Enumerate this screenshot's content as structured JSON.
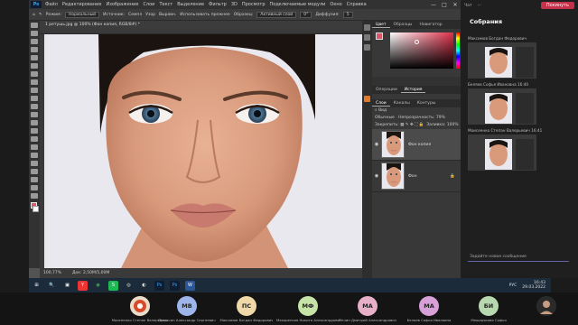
{
  "photoshop": {
    "menu": [
      "Файл",
      "Редактирование",
      "Изображение",
      "Слои",
      "Текст",
      "Выделение",
      "Фильтр",
      "3D",
      "Просмотр",
      "Подключаемые модули",
      "Окно",
      "Справка"
    ],
    "logo": "Ps",
    "window_controls": [
      "—",
      "□",
      "✕"
    ],
    "options": {
      "mode_label": "Режим:",
      "mode_value": "Нормальный",
      "source_label": "Источник:",
      "source_sample": "Семпл",
      "source_pattern": "Узор",
      "aligned": "Выравн.",
      "use_legacy": "Использовать прежнее",
      "sample_label": "Образец:",
      "sample_value": "Активный слой",
      "angle": "0°",
      "diffusion_label": "Диффузия:",
      "diffusion_value": "5"
    },
    "doc_tab": "1 ретушь.jpg @ 100% (Фон копия, RGB/8#) *",
    "status": {
      "zoom": "100,77%",
      "doc": "Док: 2,50М/5,00М"
    },
    "color_tabs": [
      "Цвет",
      "Образцы",
      "Навигатор"
    ],
    "history_tabs": [
      "Операции",
      "История"
    ],
    "layers_tabs": [
      "Слои",
      "Каналы",
      "Контуры"
    ],
    "layers": {
      "kind": "Вид",
      "blend": "Обычные",
      "opacity_label": "Непрозрачность:",
      "opacity_value": "79%",
      "lock_label": "Закрепить:",
      "fill_label": "Заливка:",
      "fill_value": "100%",
      "items": [
        {
          "name": "Фон копия",
          "active": true
        },
        {
          "name": "Фон",
          "active": false
        }
      ]
    },
    "colors": {
      "fg": "#d85a6a",
      "picker_hue": "#e0304a"
    }
  },
  "chat": {
    "top_label": "Чат",
    "leave_label": "Покинуть",
    "title": "Собрания",
    "messages": [
      {
        "author": "Максимов Богдан Федорович",
        "time": ""
      },
      {
        "author": "Беляев Софья Ивановна",
        "time": "16:40"
      },
      {
        "author": "Моисеенко Степан Валерьевич",
        "time": "16:41"
      }
    ],
    "new_message_placeholder": "Задайте новое сообщение"
  },
  "taskbar": {
    "apps": [
      "⊞",
      "🔍",
      "▣",
      "Y",
      "◉",
      "S",
      "◎",
      "◐",
      "Ps",
      "Ps",
      "W"
    ],
    "lang": "РУС",
    "time": "16:43",
    "date": "29.03.2022"
  },
  "participants": [
    {
      "initials": "",
      "name": "Моисеенко Степан Валерьевич",
      "color": "#d86a3a",
      "photo": true
    },
    {
      "initials": "МВ",
      "name": "Прошкин Александр Сергеевич",
      "color": "#9db5e8",
      "photo": false
    },
    {
      "initials": "ПС",
      "name": "Максимов Богдан Федорович",
      "color": "#f0d9a8",
      "photo": false
    },
    {
      "initials": "МФ",
      "name": "Макаренков Никита Александрович",
      "color": "#c6e3a8",
      "photo": false
    },
    {
      "initials": "МА",
      "name": "Мечин Дмитрий Александрович",
      "color": "#e8b0c8",
      "photo": false
    },
    {
      "initials": "МА",
      "name": "Беляев Софья Ивановна",
      "color": "#d8a0d8",
      "photo": false
    },
    {
      "initials": "БИ",
      "name": "Мещерякова Софья",
      "color": "#b8d8b0",
      "photo": false
    },
    {
      "initials": "",
      "name": "",
      "color": "#333333",
      "photo": true
    }
  ]
}
